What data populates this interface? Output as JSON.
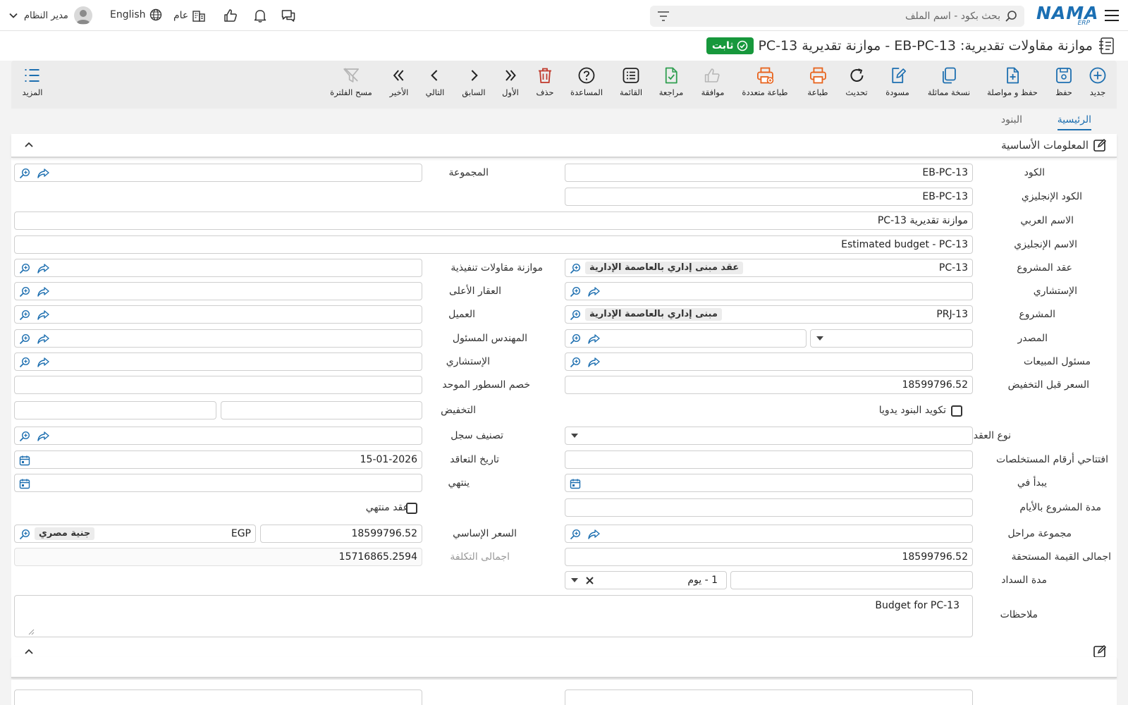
{
  "topbar": {
    "user": "مدير النظام",
    "language": "English",
    "branch": "عام",
    "search_placeholder": "بحث بكود - اسم الملف",
    "logo_text": "NAMA",
    "logo_sub": "ERP"
  },
  "page": {
    "title": "موازنة مقاولات تقديرية: EB-PC-13 - موازنة تقديرية PC-13",
    "status": "ثابت"
  },
  "toolbar": {
    "new": "جديد",
    "save": "حفظ",
    "save_continue": "حفظ و مواصلة",
    "duplicate": "نسخة مماثلة",
    "draft": "مسودة",
    "refresh": "تحديث",
    "print": "طباعة",
    "multi_print": "طباعة متعددة",
    "approve": "موافقة",
    "review": "مراجعة",
    "list": "القائمة",
    "help": "المساعدة",
    "delete": "حذف",
    "first": "الأول",
    "previous": "السابق",
    "next": "التالي",
    "last": "الأخير",
    "clear_filter": "مسح الفلترة",
    "more": "المزيد"
  },
  "tabs": {
    "main": "الرئيسية",
    "items": "البنود"
  },
  "section": {
    "title": "المعلومات الأساسية"
  },
  "form": {
    "code": {
      "label": "الكود",
      "value": "EB-PC-13"
    },
    "en_code": {
      "label": "الكود الإنجليزي",
      "value": "EB-PC-13"
    },
    "ar_name": {
      "label": "الاسم العربي",
      "value": "موازنة تقديرية PC-13"
    },
    "en_name": {
      "label": "الاسم الإنجليزي",
      "value": "Estimated budget - PC-13"
    },
    "group": {
      "label": "المجموعة"
    },
    "project_contract": {
      "label": "عقد المشروع",
      "value": "PC-13",
      "chip": "عقد مبنى إداري بالعاصمة الإدارية"
    },
    "exec_budget": {
      "label": "موازنة مقاولات تنفيذية"
    },
    "consultant": {
      "label": "الإستشاري"
    },
    "parent_property": {
      "label": "العقار الأعلى"
    },
    "project": {
      "label": "المشروع",
      "value": "PRJ-13",
      "chip": "مبنى إداري بالعاصمة الإدارية"
    },
    "customer": {
      "label": "العميل"
    },
    "source": {
      "label": "المصدر"
    },
    "responsible_engineer": {
      "label": "المهندس المسئول"
    },
    "sales_person": {
      "label": "مسئول المبيعات"
    },
    "consultant2": {
      "label": "الإستشاري"
    },
    "price_before_discount": {
      "label": "السعر قبل التخفيض",
      "value": "18599796.52"
    },
    "unified_line_discount": {
      "label": "خصم السطور الموحد"
    },
    "manual_item_coding": {
      "label": "تكويد البنود يدويا"
    },
    "discount": {
      "label": "التخفيض"
    },
    "contract_type": {
      "label": "نوع العقد"
    },
    "record_class": {
      "label": "تصنيف سجل"
    },
    "extract_prefix": {
      "label": "افتتاحي أرقام المستخلصات"
    },
    "contract_date": {
      "label": "تاريخ التعاقد",
      "value": "15-01-2026"
    },
    "starts_at": {
      "label": "يبدأ في"
    },
    "ends": {
      "label": "ينتهي"
    },
    "duration_days": {
      "label": "مدة المشروع بالأيام"
    },
    "finished_contract": {
      "label": "عقد منتهي"
    },
    "stages_group": {
      "label": "مجموعة مراحل"
    },
    "base_price": {
      "label": "السعر الإساسي",
      "value": "18599796.52",
      "currency_code": "EGP",
      "currency_name": "جنية مصري"
    },
    "total_due": {
      "label": "اجمالى القيمة المستحقة",
      "value": "18599796.52"
    },
    "total_cost": {
      "label": "اجمالى التكلفة",
      "value": "15716865.2594"
    },
    "payment_period": {
      "label": "مدة السداد",
      "value": "1 - يوم"
    },
    "notes": {
      "label": "ملاحظات",
      "value": "Budget for PC-13"
    }
  },
  "colors": {
    "accent": "#1d6fb0",
    "status": "#17983c",
    "orange": "#e8631c",
    "delete": "#c0392b",
    "green": "#2e9e4f"
  }
}
